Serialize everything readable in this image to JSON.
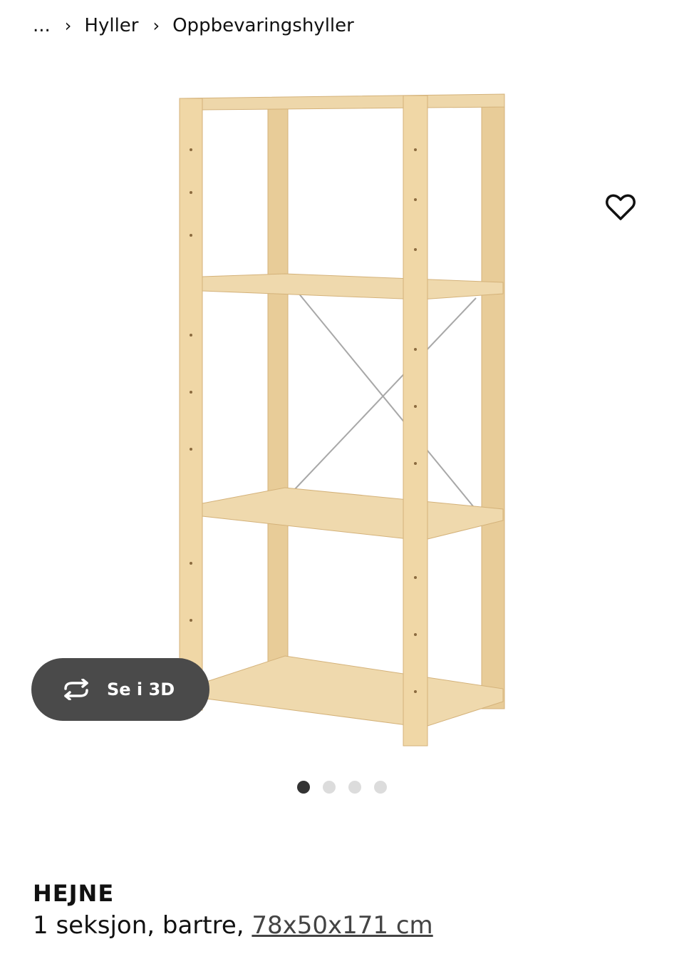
{
  "breadcrumb": {
    "ellipsis": "...",
    "items": [
      "Hyller",
      "Oppbevaringshyller"
    ]
  },
  "gallery": {
    "view3d_label": "Se i 3D",
    "dots": 4,
    "active_dot": 0
  },
  "icons": {
    "favorite": "heart-icon",
    "view3d": "rotate-3d-icon",
    "separator": "chevron-right-icon"
  },
  "product": {
    "name": "HEJNE",
    "description": "1 seksjon, bartre,",
    "measurements": "78x50x171 cm"
  },
  "colors": {
    "wood": "#ecd3a0",
    "pill_bg": "#4a4a4a",
    "dot_active": "#333333",
    "dot_inactive": "#dcdcdc"
  }
}
